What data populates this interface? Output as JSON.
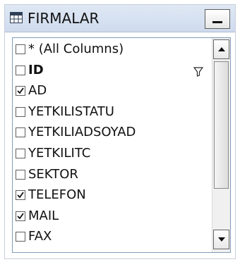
{
  "window": {
    "title": "FIRMALAR",
    "title_icon": "table-grid-icon",
    "minimize_icon": "minimize-icon"
  },
  "columns": [
    {
      "label": "* (All Columns)",
      "checked": false,
      "bold": false,
      "filtered": false
    },
    {
      "label": "ID",
      "checked": false,
      "bold": true,
      "filtered": true
    },
    {
      "label": "AD",
      "checked": true,
      "bold": false,
      "filtered": false
    },
    {
      "label": "YETKILISTATU",
      "checked": false,
      "bold": false,
      "filtered": false
    },
    {
      "label": "YETKILIADSOYAD",
      "checked": false,
      "bold": false,
      "filtered": false
    },
    {
      "label": "YETKILITC",
      "checked": false,
      "bold": false,
      "filtered": false
    },
    {
      "label": "SEKTOR",
      "checked": false,
      "bold": false,
      "filtered": false
    },
    {
      "label": "TELEFON",
      "checked": true,
      "bold": false,
      "filtered": false
    },
    {
      "label": "MAIL",
      "checked": true,
      "bold": false,
      "filtered": false
    },
    {
      "label": "FAX",
      "checked": false,
      "bold": false,
      "filtered": false
    }
  ],
  "icons": {
    "checkbox_checked": "check-icon",
    "filter": "filter-icon",
    "scroll_up": "chevron-up-icon",
    "scroll_down": "chevron-down-icon"
  }
}
